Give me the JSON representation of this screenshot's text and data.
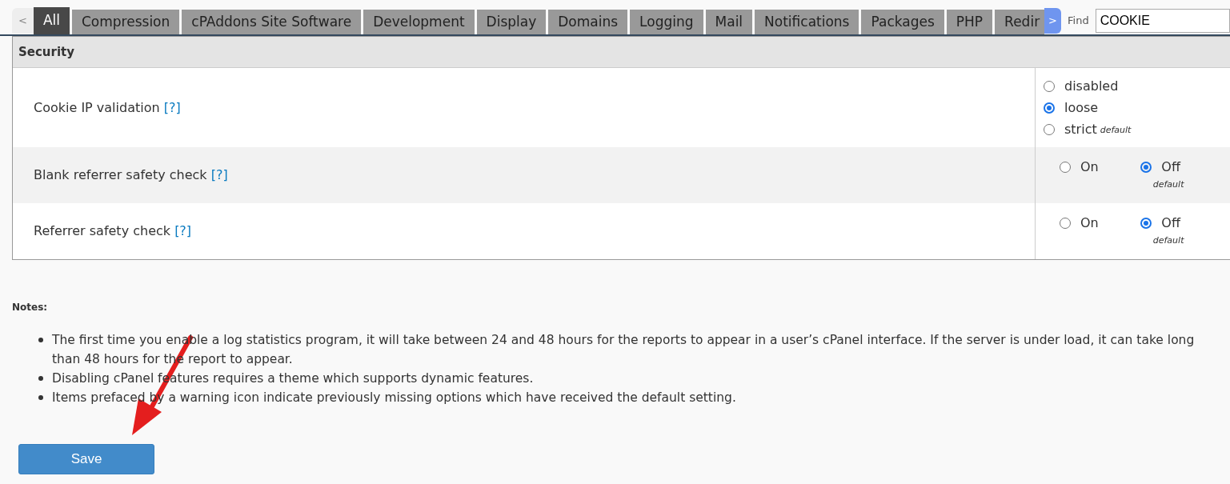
{
  "tabs": {
    "prev": "<",
    "next": ">",
    "items": [
      {
        "label": "All",
        "selected": true
      },
      {
        "label": "Compression",
        "selected": false
      },
      {
        "label": "cPAddons Site Software",
        "selected": false
      },
      {
        "label": "Development",
        "selected": false
      },
      {
        "label": "Display",
        "selected": false
      },
      {
        "label": "Domains",
        "selected": false
      },
      {
        "label": "Logging",
        "selected": false
      },
      {
        "label": "Mail",
        "selected": false
      },
      {
        "label": "Notifications",
        "selected": false
      },
      {
        "label": "Packages",
        "selected": false
      },
      {
        "label": "PHP",
        "selected": false
      },
      {
        "label": "Redir",
        "selected": false
      }
    ]
  },
  "find": {
    "label": "Find",
    "value": "COOKIE"
  },
  "section": {
    "title": "Security",
    "rows": [
      {
        "label": "Cookie IP validation",
        "help": "[?]",
        "kind": "list",
        "options": [
          {
            "label": "disabled",
            "selected": false
          },
          {
            "label": "loose",
            "selected": true
          },
          {
            "label": "strict",
            "selected": false,
            "note": "default"
          }
        ]
      },
      {
        "label": "Blank referrer safety check",
        "help": "[?]",
        "kind": "inline",
        "options": [
          {
            "label": "On",
            "selected": false
          },
          {
            "label": "Off",
            "selected": true,
            "note": "default"
          }
        ]
      },
      {
        "label": "Referrer safety check",
        "help": "[?]",
        "kind": "inline",
        "options": [
          {
            "label": "On",
            "selected": false
          },
          {
            "label": "Off",
            "selected": true,
            "note": "default"
          }
        ]
      }
    ]
  },
  "notes": {
    "title": "Notes:",
    "items": [
      {
        "lines": [
          "The first time you enable a log statistics program, it will take between 24 and 48 hours for the reports to appear in a user’s cPanel interface. If the server is under load, it can take long",
          "than 48 hours for the report to appear."
        ]
      },
      {
        "lines": [
          "Disabling cPanel features requires a theme which supports dynamic features."
        ]
      },
      {
        "lines": [
          "Items prefaced by a warning icon indicate previously missing options which have received the default setting."
        ]
      }
    ]
  },
  "save": "Save"
}
